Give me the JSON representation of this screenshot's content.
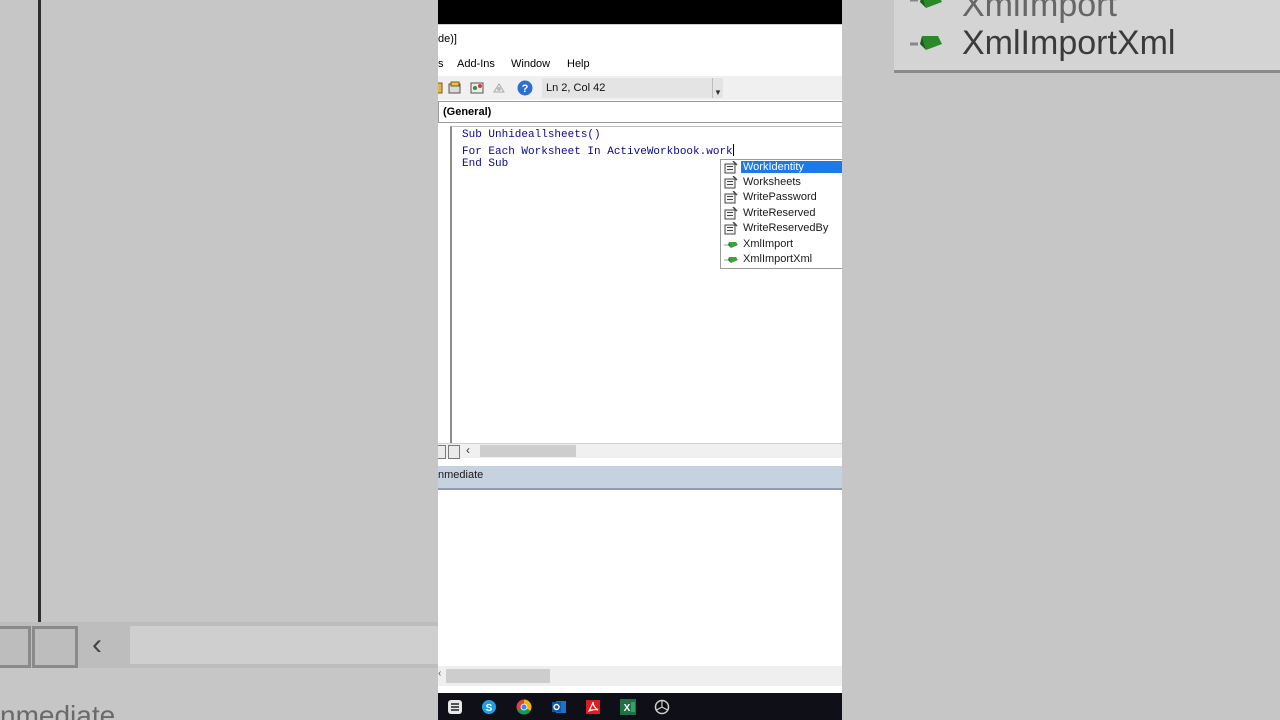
{
  "window": {
    "title_fragment": "de)]"
  },
  "menu": [
    {
      "label": "s"
    },
    {
      "label": "Add-Ins"
    },
    {
      "label": "Window"
    },
    {
      "label": "Help"
    }
  ],
  "toolbar": {
    "status": "Ln 2, Col 42"
  },
  "object_dropdown": {
    "value": "(General)"
  },
  "code": {
    "lines": [
      "Sub Unhideallsheets()",
      "For Each Worksheet In ActiveWorkbook.work",
      "End Sub"
    ]
  },
  "autocomplete": {
    "items": [
      {
        "label": "WorkIdentity",
        "icon": "property-icon",
        "selected": true
      },
      {
        "label": "Worksheets",
        "icon": "property-icon",
        "selected": false
      },
      {
        "label": "WritePassword",
        "icon": "property-icon",
        "selected": false
      },
      {
        "label": "WriteReserved",
        "icon": "property-icon",
        "selected": false
      },
      {
        "label": "WriteReservedBy",
        "icon": "property-icon",
        "selected": false
      },
      {
        "label": "XmlImport",
        "icon": "method-icon",
        "selected": false
      },
      {
        "label": "XmlImportXml",
        "icon": "method-icon",
        "selected": false
      }
    ]
  },
  "immediate": {
    "title": "nmediate"
  },
  "background": {
    "right_items": [
      "XmlImport",
      "XmlImportXml"
    ],
    "left_bottom_text": "nmediate"
  },
  "taskbar": {
    "apps": [
      "snipping-tool-icon",
      "skype-icon",
      "chrome-icon",
      "outlook-icon",
      "acrobat-icon",
      "excel-icon",
      "camera-icon"
    ]
  },
  "colors": {
    "selection": "#1c79e8",
    "code_text": "#0a0a8a",
    "immediate_header": "#c6d2e0"
  }
}
